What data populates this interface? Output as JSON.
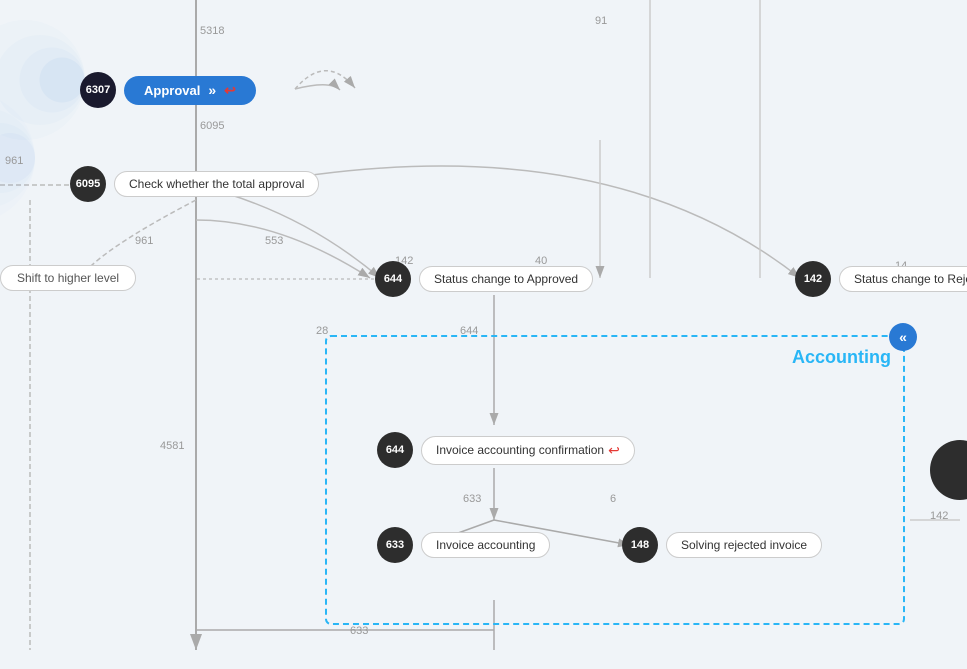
{
  "nodes": {
    "n6307": {
      "id": "6307",
      "label": "Approval"
    },
    "n6095": {
      "id": "6095",
      "label": "Check whether the total approval"
    },
    "shift": {
      "label": "Shift to higher level"
    },
    "n644_status": {
      "id": "644",
      "label": "Status change to Approved"
    },
    "n142": {
      "id": "142",
      "label": "Status change to Reject"
    },
    "n644_invoice_confirm": {
      "id": "644",
      "label": "Invoice accounting confirmation"
    },
    "n633": {
      "id": "633",
      "label": "Invoice accounting"
    },
    "n148": {
      "id": "148",
      "label": "Solving rejected invoice"
    }
  },
  "edges": {
    "e5318": {
      "label": "5318"
    },
    "e6095": {
      "label": "6095"
    },
    "e961_left": {
      "label": "961"
    },
    "e961_bottom": {
      "label": "961"
    },
    "e553": {
      "label": "553"
    },
    "e644": {
      "label": "644"
    },
    "e142": {
      "label": "142"
    },
    "e40": {
      "label": "40"
    },
    "e91": {
      "label": "91"
    },
    "e28": {
      "label": "28"
    },
    "e633_mid": {
      "label": "633"
    },
    "e6": {
      "label": "6"
    },
    "e4581": {
      "label": "4581"
    },
    "e633_bottom": {
      "label": "633"
    },
    "e14_right": {
      "label": "14"
    },
    "e142_right": {
      "label": "142"
    }
  },
  "accounting": {
    "title": "Accounting",
    "collapse_icon": "«"
  }
}
